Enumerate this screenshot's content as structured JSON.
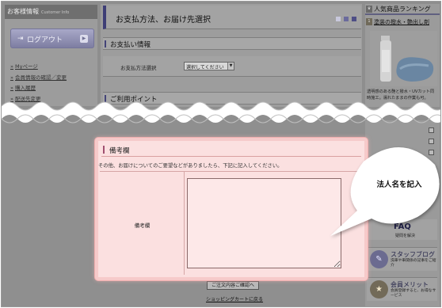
{
  "left": {
    "customer_info": "お客様情報",
    "customer_info_sub": "Customer Info",
    "logout_label": "ログアウト",
    "links": [
      "Myページ",
      "会員情報の確認／変更",
      "購入履歴",
      "配送先変更"
    ]
  },
  "main": {
    "page_title": "お支払方法、お届け先選択",
    "payment_section": "お支払い情報",
    "payment_method_label": "お支払方法選択",
    "payment_select_value": "選択してください",
    "points_section": "ご利用ポイント"
  },
  "right": {
    "ranking_title": "人気商品ランキング",
    "ranking_item": "塗装の撥水・艶出し剤",
    "product_desc": "透明感のある艶と撥水・UVカット同時施工。濡れたままの作業も可。",
    "faq_label": "FAQ",
    "faq_sub": "疑問を解決",
    "blog_label": "スタッフブログ",
    "blog_sub": "洗車や車関係の記事をご紹介",
    "merit_label": "会員メリット",
    "merit_sub": "会員登録すると、お得なサービス"
  },
  "remarks": {
    "heading": "備考欄",
    "note": "その他、お届けについてのご要望などがありましたら、下記に記入してください。",
    "field_label": "備考欄",
    "field_value": ""
  },
  "footer": {
    "confirm_button": "ご注文内容ご確認へ",
    "back_link": "ショッピングカートに戻る"
  },
  "callout": {
    "text": "法人名を記入"
  }
}
